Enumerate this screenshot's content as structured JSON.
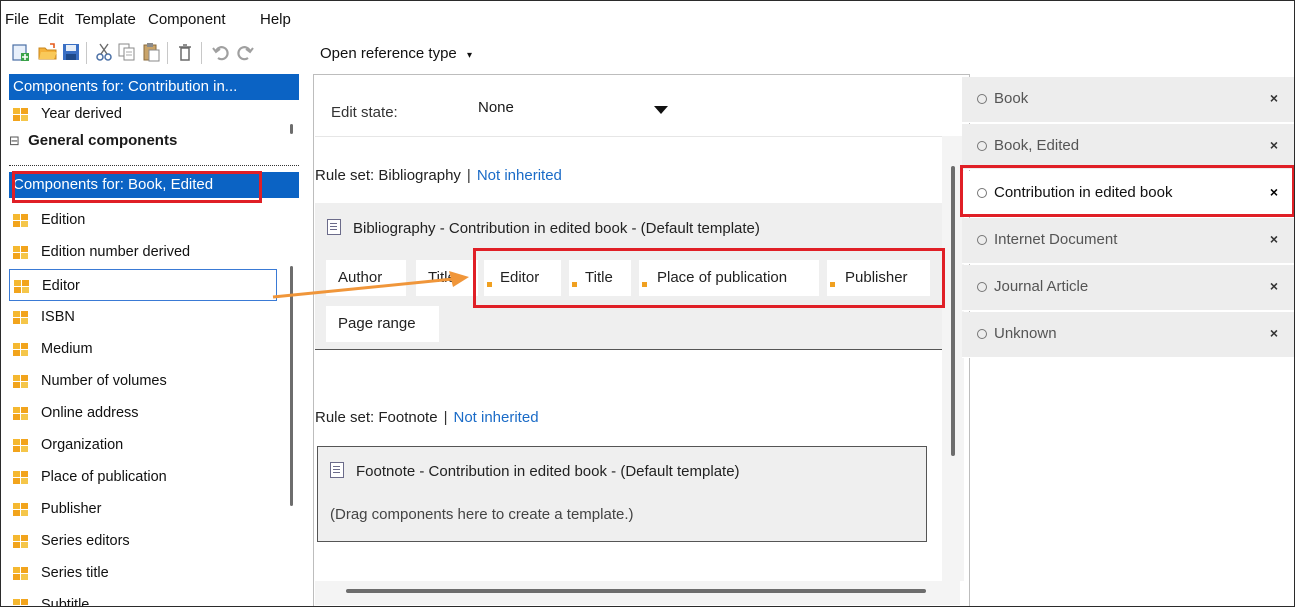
{
  "menu": [
    "File",
    "Edit",
    "Template",
    "Component",
    "Help"
  ],
  "toolbar": {
    "icons": [
      "new-icon",
      "open-folder-icon",
      "save-icon",
      "cut-icon",
      "copy-icon",
      "paste-icon",
      "delete-icon",
      "undo-icon",
      "redo-icon"
    ],
    "open_reference_type": "Open reference type"
  },
  "left": {
    "header_top": "Components for: Contribution in...",
    "year_derived": "Year derived",
    "general_components": "General components",
    "header_book": "Components for: Book, Edited",
    "items": [
      "Edition",
      "Edition number derived",
      "Editor",
      "ISBN",
      "Medium",
      "Number of volumes",
      "Online address",
      "Organization",
      "Place of publication",
      "Publisher",
      "Series editors",
      "Series title",
      "Subtitle"
    ],
    "selected": "Editor"
  },
  "edit_state": {
    "label": "Edit state:",
    "value": "None"
  },
  "bibliography": {
    "rule_set": "Rule set: Bibliography",
    "separator": "|",
    "inherited": "Not inherited",
    "title": "Bibliography - Contribution in edited book - (Default template)",
    "components": [
      "Author",
      "Title",
      "Editor",
      "Title",
      "Place of publication",
      "Publisher",
      "Page range"
    ]
  },
  "footnote": {
    "rule_set": "Rule set: Footnote",
    "separator": "|",
    "inherited": "Not inherited",
    "title": "Footnote - Contribution in edited book - (Default template)",
    "hint": "(Drag components here to create a template.)"
  },
  "reference_types": [
    {
      "label": "Book",
      "close": "×"
    },
    {
      "label": "Book, Edited",
      "close": "×"
    },
    {
      "label": "Contribution in edited book",
      "close": "×"
    },
    {
      "label": "Internet Document",
      "close": "×"
    },
    {
      "label": "Journal Article",
      "close": "×"
    },
    {
      "label": "Unknown",
      "close": "×"
    }
  ],
  "active_reference_type": "Contribution in edited book",
  "colors": {
    "header_blue": "#0b63c4",
    "annotation_red": "#e01f26",
    "arrow_orange": "#f0963a",
    "link_blue": "#1a6bc7"
  }
}
